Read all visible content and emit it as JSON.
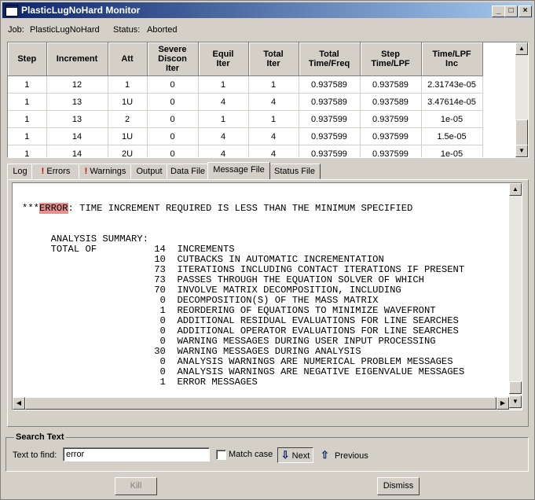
{
  "window": {
    "title": "PlasticLugNoHard Monitor"
  },
  "job": {
    "label": "Job:",
    "name": "PlasticLugNoHard",
    "status_label": "Status:",
    "status": "Aborted"
  },
  "table": {
    "headers": [
      [
        "Step"
      ],
      [
        "Increment"
      ],
      [
        "Att"
      ],
      [
        "Severe",
        "Discon",
        "Iter"
      ],
      [
        "Equil",
        "Iter"
      ],
      [
        "Total",
        "Iter"
      ],
      [
        "Total",
        "Time/Freq"
      ],
      [
        "Step",
        "Time/LPF"
      ],
      [
        "Time/LPF",
        "Inc"
      ]
    ],
    "rows": [
      [
        "1",
        "12",
        "1",
        "0",
        "1",
        "1",
        "0.937589",
        "0.937589",
        "2.31743e-05"
      ],
      [
        "1",
        "13",
        "1U",
        "0",
        "4",
        "4",
        "0.937589",
        "0.937589",
        "3.47614e-05"
      ],
      [
        "1",
        "13",
        "2",
        "0",
        "1",
        "1",
        "0.937599",
        "0.937599",
        "1e-05"
      ],
      [
        "1",
        "14",
        "1U",
        "0",
        "4",
        "4",
        "0.937599",
        "0.937599",
        "1.5e-05"
      ],
      [
        "1",
        "14",
        "2U",
        "0",
        "4",
        "4",
        "0.937599",
        "0.937599",
        "1e-05"
      ]
    ]
  },
  "tabs": [
    {
      "label": "Log",
      "warn": false
    },
    {
      "label": "Errors",
      "warn": true
    },
    {
      "label": "Warnings",
      "warn": true
    },
    {
      "label": "Output",
      "warn": false
    },
    {
      "label": "Data File",
      "warn": false
    },
    {
      "label": "Message File",
      "warn": false,
      "active": true
    },
    {
      "label": "Status File",
      "warn": false
    }
  ],
  "message": {
    "prefix": "***",
    "highlight": "ERROR",
    "error_rest": ": TIME INCREMENT REQUIRED IS LESS THAN THE MINIMUM SPECIFIED",
    "body": "\n\n\n     ANALYSIS SUMMARY:\n     TOTAL OF          14  INCREMENTS\n                       10  CUTBACKS IN AUTOMATIC INCREMENTATION\n                       73  ITERATIONS INCLUDING CONTACT ITERATIONS IF PRESENT\n                       73  PASSES THROUGH THE EQUATION SOLVER OF WHICH\n                       70  INVOLVE MATRIX DECOMPOSITION, INCLUDING\n                        0  DECOMPOSITION(S) OF THE MASS MATRIX\n                        1  REORDERING OF EQUATIONS TO MINIMIZE WAVEFRONT\n                        0  ADDITIONAL RESIDUAL EVALUATIONS FOR LINE SEARCHES\n                        0  ADDITIONAL OPERATOR EVALUATIONS FOR LINE SEARCHES\n                        0  WARNING MESSAGES DURING USER INPUT PROCESSING\n                       30  WARNING MESSAGES DURING ANALYSIS\n                        0  ANALYSIS WARNINGS ARE NUMERICAL PROBLEM MESSAGES\n                        0  ANALYSIS WARNINGS ARE NEGATIVE EIGENVALUE MESSAGES\n                        1  ERROR MESSAGES"
  },
  "search": {
    "group_label": "Search Text",
    "find_label": "Text to find:",
    "find_value": "error",
    "match_case_label": "Match case",
    "match_case_checked": false,
    "next_label": "Next",
    "previous_label": "Previous"
  },
  "buttons": {
    "kill": "Kill",
    "dismiss": "Dismiss"
  },
  "icons": {
    "warn_color": "#d00000",
    "highlight_color": "#e89090",
    "titlebar_color": "#0a246a"
  }
}
